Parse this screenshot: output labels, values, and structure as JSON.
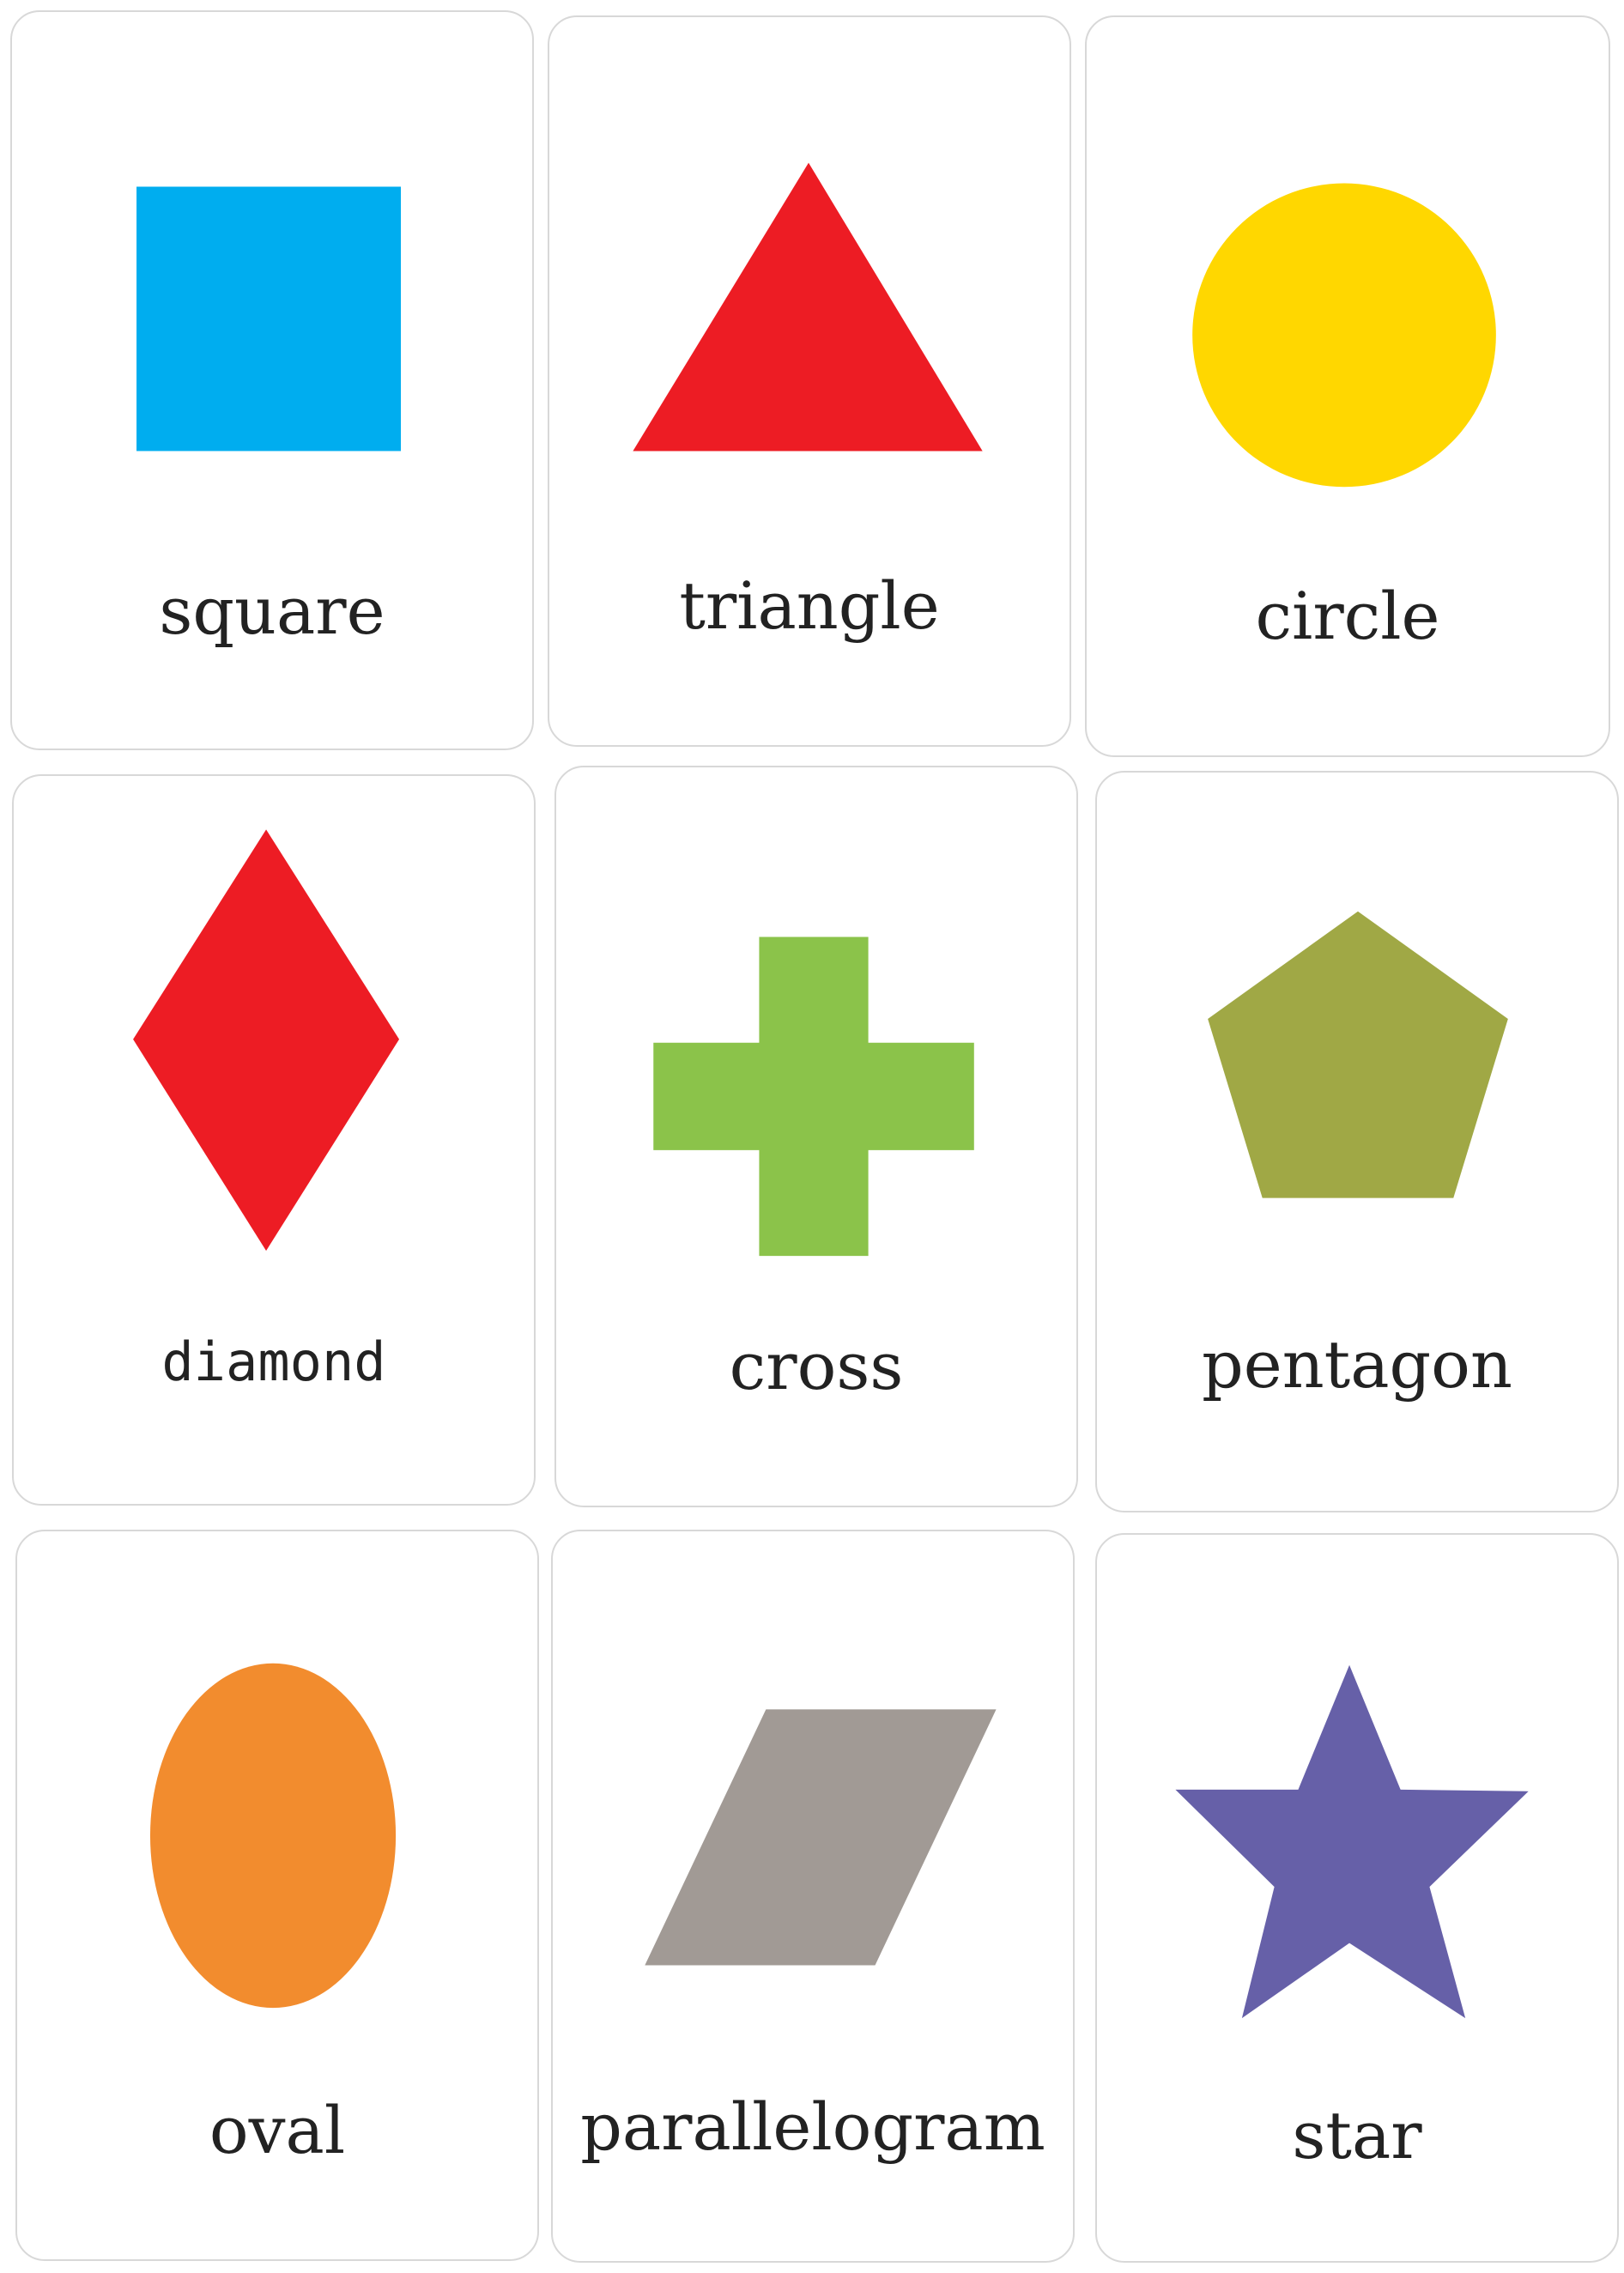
{
  "cards": [
    {
      "label": "square",
      "shape": "square",
      "color": "#00ADEF"
    },
    {
      "label": "triangle",
      "shape": "triangle",
      "color": "#ED1C24"
    },
    {
      "label": "circle",
      "shape": "circle",
      "color": "#FFD700"
    },
    {
      "label": "diamond",
      "shape": "diamond",
      "color": "#ED1C24"
    },
    {
      "label": "cross",
      "shape": "cross",
      "color": "#8BC34A"
    },
    {
      "label": "pentagon",
      "shape": "pentagon",
      "color": "#A0A845"
    },
    {
      "label": "oval",
      "shape": "oval",
      "color": "#F28C2E"
    },
    {
      "label": "parallelogram",
      "shape": "parallelogram",
      "color": "#A19A95"
    },
    {
      "label": "star",
      "shape": "star",
      "color": "#6660A8"
    }
  ]
}
